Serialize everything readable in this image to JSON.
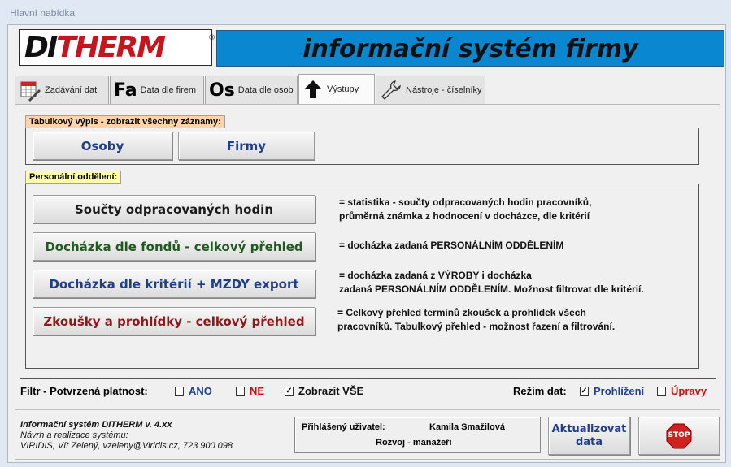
{
  "window": {
    "title": "Hlavní nabídka"
  },
  "header": {
    "logo_main": "DI",
    "logo_accent": "THERM",
    "logo_reg": "®",
    "banner": "informační systém firmy"
  },
  "tabs": [
    {
      "label": "Zadávání dat",
      "icon": "calendar-pen-icon"
    },
    {
      "label": "Data dle firem",
      "prefix": "Fa",
      "icon": "fa-letters-icon"
    },
    {
      "label": "Data dle osob",
      "prefix": "Os",
      "icon": "os-letters-icon"
    },
    {
      "label": "Výstupy",
      "icon": "arrow-up-icon",
      "active": true
    },
    {
      "label": "Nástroje - číselníky",
      "icon": "wrench-icon"
    }
  ],
  "table_group": {
    "label": "Tabulkový výpis - zobrazit všechny záznamy:",
    "buttons": [
      "Osoby",
      "Firmy"
    ]
  },
  "personal_group": {
    "label": "Personální oddělení:",
    "items": [
      {
        "button": "Součty odpracovaných hodin",
        "color": "#1a1a1a",
        "desc1": "= statistika - součty odpracovaných hodin pracovníků,",
        "desc2": "průměrná známka z hodnocení v docházce, dle kritérií"
      },
      {
        "button": "Docházka dle fondů -  celkový přehled",
        "color": "#1f5a1f",
        "desc1": "= docházka zadaná PERSONÁLNÍM ODDĚLENÍM",
        "desc2": ""
      },
      {
        "button": "Docházka dle kritérií + MZDY export",
        "color": "#1f3f8a",
        "desc1": "= docházka zadaná z VÝROBY i docházka",
        "desc2": "zadaná PERSONÁLNÍM ODDĚLENÍM. Možnost filtrovat dle kritérií."
      },
      {
        "button": "Zkoušky a prohlídky - celkový přehled",
        "color": "#8a1a1a",
        "desc1": "= Celkový přehled termínů zkoušek a prohlídek všech",
        "desc2": "pracovníků.  Tabulkový přehled - možnost řazení a filtrování."
      }
    ]
  },
  "filter": {
    "label": "Filtr - Potvrzená platnost:",
    "options": [
      {
        "label": "ANO",
        "checked": false,
        "color": "#1f3fa0"
      },
      {
        "label": "NE",
        "checked": false,
        "color": "#d01010"
      },
      {
        "label": "Zobrazit VŠE",
        "checked": true,
        "color": "#111111"
      }
    ],
    "mode_label": "Režim dat:",
    "modes": [
      {
        "label": "Prohlížení",
        "checked": true,
        "color": "#1f3fa0"
      },
      {
        "label": "Úpravy",
        "checked": false,
        "color": "#d01010"
      }
    ]
  },
  "footer": {
    "line1": "Informační systém DITHERM v. 4.xx",
    "line2": "Návrh a realizace systému:",
    "line3": "VIRIDIS, Vít Zelený, vzeleny@Viridis.cz, 723 900 098",
    "user_label": "Přihlášený uživatel:",
    "user_name": "Kamila Smažilová",
    "user_role": "Rozvoj - manažeři",
    "refresh_line1": "Aktualizovat",
    "refresh_line2": "data",
    "stop_label": "STOP"
  }
}
